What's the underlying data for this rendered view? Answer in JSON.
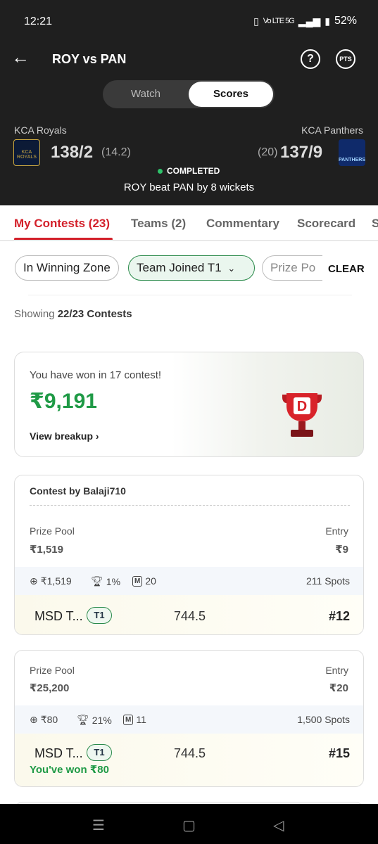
{
  "status_bar": {
    "time": "12:21",
    "network": "Vo LTE 5G",
    "battery": "52%"
  },
  "header": {
    "title": "ROY vs PAN",
    "help_icon": "?",
    "pts_icon": "PTS",
    "toggle": {
      "watch": "Watch",
      "scores": "Scores"
    }
  },
  "match": {
    "team_left": {
      "name": "KCA Royals",
      "score": "138/2",
      "overs": "(14.2)",
      "logo_text": "KCA ROYALS"
    },
    "team_right": {
      "name": "KCA Panthers",
      "score": "137/9",
      "overs": "(20)",
      "logo_text": "PANTHERS"
    },
    "status": "COMPLETED",
    "status_color": "#2ec26a",
    "result": "ROY beat PAN by 8 wickets"
  },
  "tabs": [
    {
      "label": "My Contests (23)",
      "active": true
    },
    {
      "label": "Teams (2)"
    },
    {
      "label": "Commentary"
    },
    {
      "label": "Scorecard"
    },
    {
      "label": "S"
    }
  ],
  "filters": {
    "winning_zone": "In Winning Zone",
    "team_joined": "Team Joined T1",
    "prize": "Prize Po",
    "clear": "CLEAR"
  },
  "showing": {
    "prefix": "Showing ",
    "count": "22/23 Contests"
  },
  "won_summary": {
    "text": "You have won in 17 contest!",
    "amount": "₹9,191",
    "breakup": "View breakup"
  },
  "contests": [
    {
      "by": "Contest by Balaji710",
      "prize_label": "Prize Pool",
      "prize": "₹1,519",
      "entry_label": "Entry",
      "entry": "₹9",
      "first_prize": "₹1,519",
      "winners_pct": "1%",
      "max_teams": "20",
      "spots": "211 Spots",
      "team": "MSD T...",
      "badge": "T1",
      "points": "744.5",
      "rank": "#12"
    },
    {
      "prize_label": "Prize Pool",
      "prize": "₹25,200",
      "entry_label": "Entry",
      "entry": "₹20",
      "first_prize": "₹80",
      "winners_pct": "21%",
      "max_teams": "11",
      "spots": "1,500 Spots",
      "team": "MSD T...",
      "badge": "T1",
      "points": "744.5",
      "rank": "#15",
      "won": "You've won ₹80"
    }
  ],
  "accent_color": "#d3202a"
}
